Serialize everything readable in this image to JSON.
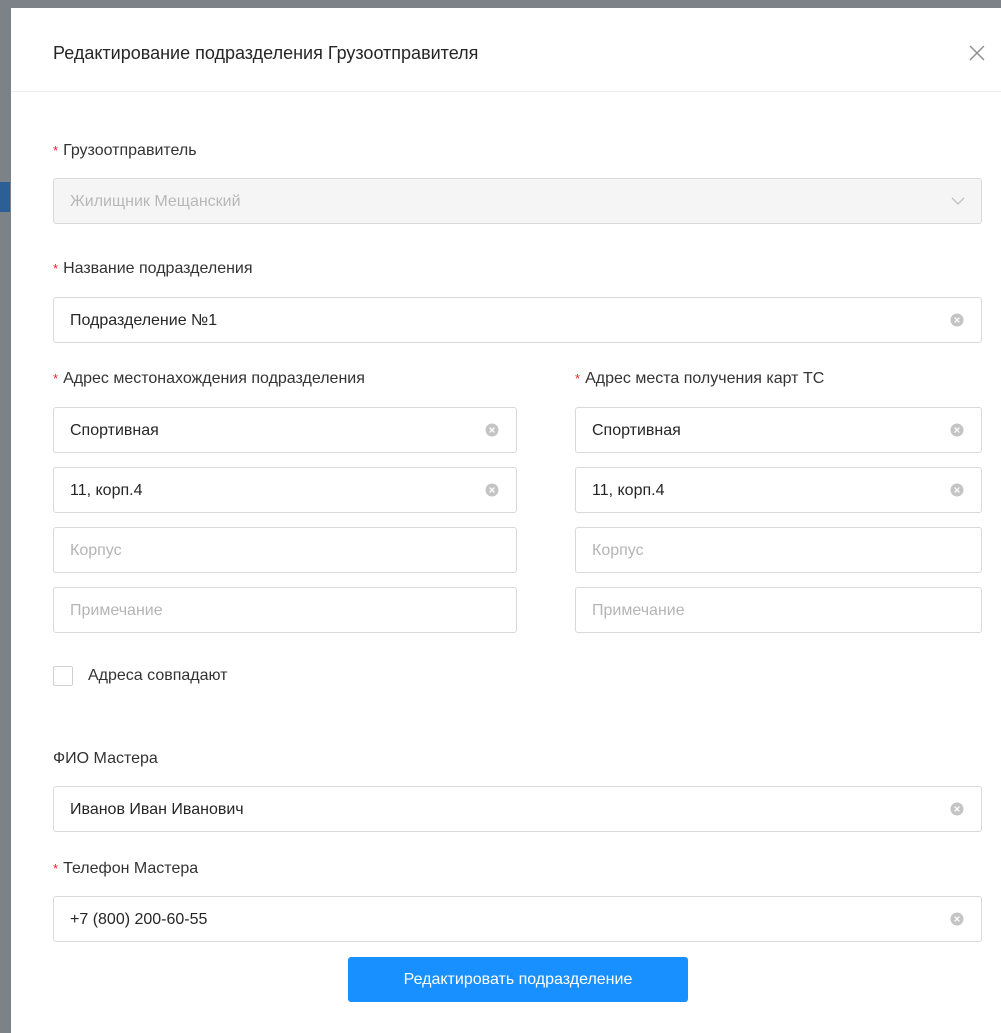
{
  "modal": {
    "title": "Редактирование подразделения Грузоотправителя",
    "close_icon": "close-icon"
  },
  "form": {
    "shipper": {
      "label": "Грузоотправитель",
      "required_mark": "*",
      "value": "Жилищник Мещанский",
      "disabled": true
    },
    "division_name": {
      "label": "Название подразделения",
      "required_mark": "*",
      "value": "Подразделение №1"
    },
    "location_address": {
      "label": "Адрес местонахождения подразделения",
      "required_mark": "*",
      "street": "Спортивная",
      "house": "11, корп.4",
      "building_placeholder": "Корпус",
      "note_placeholder": "Примечание"
    },
    "card_address": {
      "label": "Адрес места получения карт ТС",
      "required_mark": "*",
      "street": "Спортивная",
      "house": "11, корп.4",
      "building_placeholder": "Корпус",
      "note_placeholder": "Примечание"
    },
    "same_address": {
      "label": "Адреса совпадают",
      "checked": false
    },
    "master_name": {
      "label": "ФИО Мастера",
      "value": "Иванов Иван Иванович"
    },
    "master_phone": {
      "label": "Телефон Мастера",
      "required_mark": "*",
      "value": "+7 (800) 200-60-55"
    },
    "submit_label": "Редактировать подразделение"
  },
  "colors": {
    "primary": "#1890ff",
    "required": "#f5222d",
    "border": "#d9d9d9",
    "disabled_bg": "#f5f5f5"
  }
}
